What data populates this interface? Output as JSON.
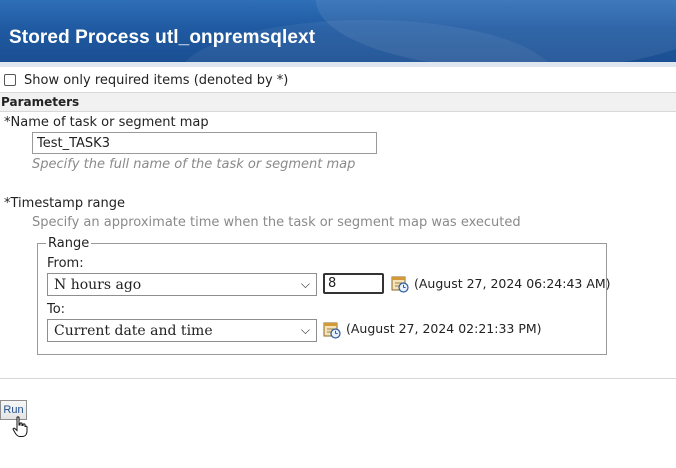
{
  "header": {
    "title": "Stored Process utl_onpremsqlext"
  },
  "options": {
    "show_required_label": "Show only required items (denoted by *)"
  },
  "section": {
    "label": "Parameters"
  },
  "task_field": {
    "label": "*Name of task or segment map",
    "value": "Test_TASK3",
    "help": "Specify the full name of the task or segment map"
  },
  "timestamp": {
    "label": "*Timestamp range",
    "help": "Specify an approximate time when the task or segment map was executed",
    "legend": "Range",
    "from_label": "From:",
    "from_select": "N hours ago",
    "from_number": "8",
    "from_resolved": "(August 27, 2024 06:24:43 AM)",
    "to_label": "To:",
    "to_select": "Current date and time",
    "to_resolved": "(August 27, 2024 02:21:33 PM)"
  },
  "actions": {
    "run_label": "Run"
  },
  "colors": {
    "header_blue": "#1f5aa2",
    "help_gray": "#8a8a8a"
  },
  "icons": {
    "calendar": "calendar-clock-icon",
    "dropdown": "chevron-down-icon",
    "pointer": "hand-cursor-icon"
  }
}
